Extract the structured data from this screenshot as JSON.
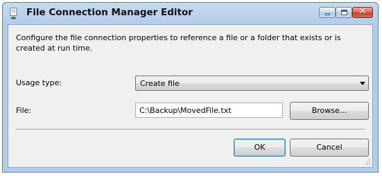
{
  "window": {
    "title": "File Connection Manager Editor",
    "close_glyph": "✕"
  },
  "description": "Configure the file connection properties to reference a file or a folder that exists or is created at run time.",
  "usage_type": {
    "label": "Usage type:",
    "selected": "Create file"
  },
  "file": {
    "label": "File:",
    "value": "C:\\Backup\\MovedFile.txt",
    "browse_label": "Browse..."
  },
  "buttons": {
    "ok_label": "OK",
    "cancel_label": "Cancel"
  },
  "colors": {
    "titlebar": "#b4cde9",
    "client_bg": "#f0f0f0",
    "close_button": "#c0432d",
    "default_button_border": "#3c7fb1"
  },
  "icons": {
    "title": "file-connection-icon",
    "minimize": "minimize-icon",
    "maximize": "maximize-icon",
    "close": "close-icon",
    "combo_arrow": "chevron-down-icon",
    "resize": "resize-grip-icon"
  }
}
